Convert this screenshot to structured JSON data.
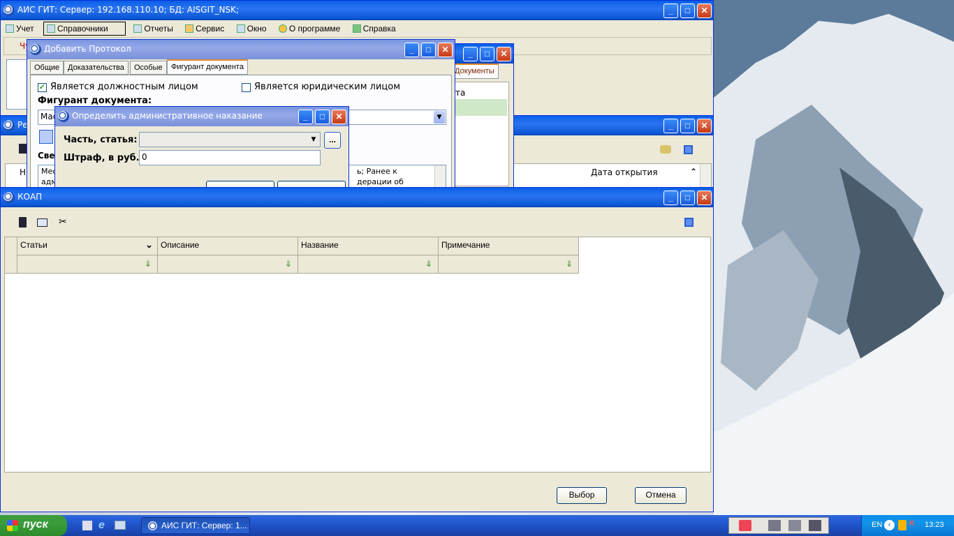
{
  "main_window": {
    "title": "АИС ГИТ:  Сервер: 192.168.110.10;   БД: AISGIT_NSK;",
    "menu": [
      {
        "label": "Учет",
        "icon": "grid-icon"
      },
      {
        "label": "Справочники",
        "icon": "book-icon"
      },
      {
        "label": "Отчеты",
        "icon": "table-icon"
      },
      {
        "label": "Сервис",
        "icon": "house-icon"
      },
      {
        "label": "Окно",
        "icon": "windows-icon"
      },
      {
        "label": "О программе",
        "icon": "about-icon"
      },
      {
        "label": "Справка",
        "icon": "help-book-icon"
      }
    ],
    "row2_text": "Чу"
  },
  "registry_window": {
    "title_fragment": "Ре",
    "tab_documents": "Документы",
    "col_fragment": "та",
    "header_fragment": "Н",
    "date_header": "Дата открытия"
  },
  "protocol_window": {
    "title": "Добавить Протокол",
    "tabs": [
      "Общие",
      "Доказательства",
      "Особые",
      "Фигурант документа"
    ],
    "active_tab": "Фигурант документа",
    "official_checkbox": "Является должностным лицом",
    "official_checked": true,
    "legal_checkbox": "Является юридическим лицом",
    "legal_checked": false,
    "figurant_label": "Фигурант документа:",
    "figurant_value": "Мас",
    "info_label": "Све",
    "memo_left": "Мес",
    "memo_left2": "адм",
    "memo_right": "ь; Ранее к",
    "memo_right2": "дерации об"
  },
  "penalty_dialog": {
    "title": "Определить административное наказание",
    "part_label": "Часть, статья:",
    "part_value": "",
    "browse_label": "...",
    "fine_label": "Штраф, в руб.:",
    "fine_value": "0"
  },
  "koap_window": {
    "title": "КОАП",
    "columns": [
      "Статьи",
      "Описание",
      "Название",
      "Примечание"
    ],
    "select_button": "Выбор",
    "cancel_button": "Отмена"
  },
  "taskbar": {
    "start_label": "пуск",
    "task_label": "АИС ГИТ:  Сервер: 1...",
    "lang": "EN",
    "clock": "13:23"
  }
}
